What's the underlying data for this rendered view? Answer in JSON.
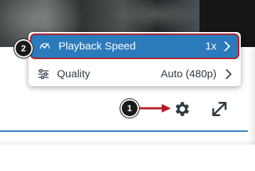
{
  "menu": {
    "items": [
      {
        "label": "Playback Speed",
        "value": "1x",
        "icon": "speedometer-icon",
        "highlighted": true
      },
      {
        "label": "Quality",
        "value": "Auto (480p)",
        "icon": "sliders-icon",
        "highlighted": false
      }
    ]
  },
  "callouts": {
    "one": "1",
    "two": "2"
  },
  "colors": {
    "accent": "#2b7abc",
    "highlight_border": "#b51d26",
    "arrow": "#b51d26",
    "icon": "#2d3b45",
    "badge": "#1a1a1a"
  }
}
